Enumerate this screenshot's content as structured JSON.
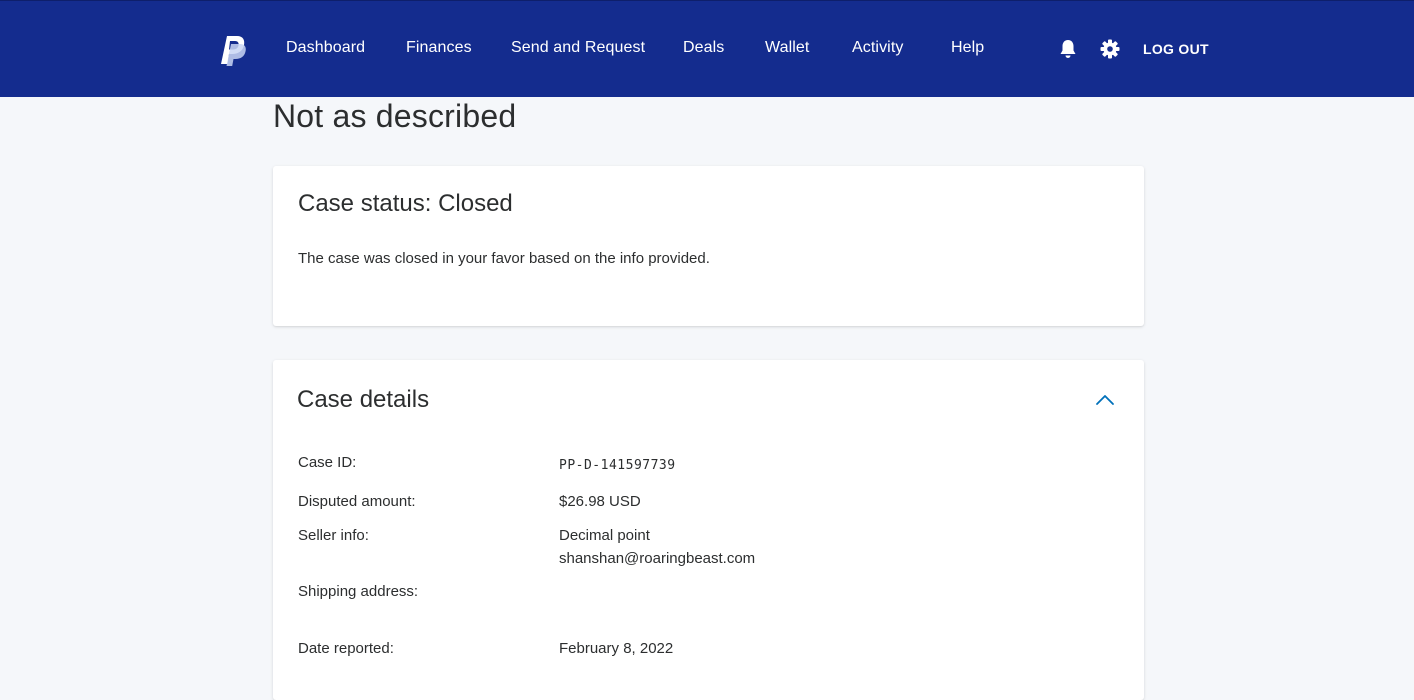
{
  "nav": {
    "items": [
      {
        "label": "Dashboard"
      },
      {
        "label": "Finances"
      },
      {
        "label": "Send and Request"
      },
      {
        "label": "Deals"
      },
      {
        "label": "Wallet"
      },
      {
        "label": "Activity"
      },
      {
        "label": "Help"
      }
    ],
    "logout_label": "LOG OUT",
    "icons": [
      "paypal-logo-icon",
      "bell-icon",
      "gear-icon"
    ]
  },
  "page": {
    "title": "Not as described"
  },
  "status_card": {
    "heading": "Case status: Closed",
    "text": "The case was closed in your favor based on the info provided."
  },
  "details_card": {
    "heading": "Case details",
    "rows": [
      {
        "label": "Case ID:",
        "value": "PP-D-141597739"
      },
      {
        "label": "Disputed amount:",
        "value": "$26.98 USD"
      },
      {
        "label": "Seller info:",
        "value": "Decimal point",
        "value2": "shanshan@roaringbeast.com"
      },
      {
        "label": "Shipping address:",
        "value": ""
      },
      {
        "label": "Date reported:",
        "value": "February 8, 2022"
      }
    ]
  },
  "colors": {
    "header_bg": "#142c8e",
    "page_bg": "#f5f7fa",
    "text": "#2c2e2f",
    "accent": "#0070ba"
  }
}
